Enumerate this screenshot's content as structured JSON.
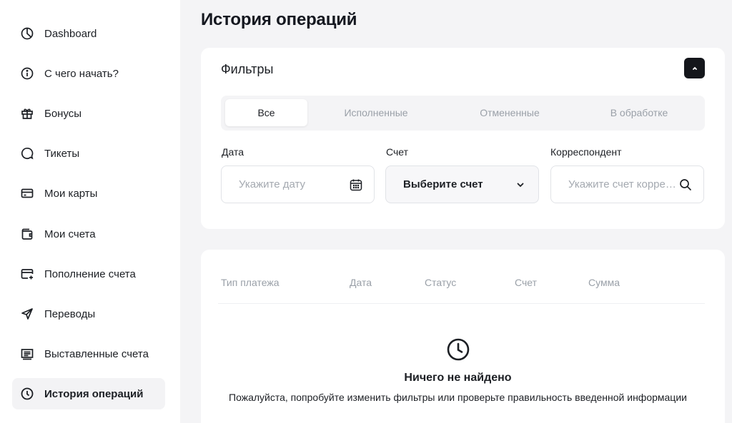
{
  "sidebar": {
    "items": [
      {
        "label": "Dashboard",
        "icon": "pie-chart-icon"
      },
      {
        "label": "С чего начать?",
        "icon": "info-icon"
      },
      {
        "label": "Бонусы",
        "icon": "gift-icon"
      },
      {
        "label": "Тикеты",
        "icon": "chat-bubble-icon"
      },
      {
        "label": "Мои карты",
        "icon": "credit-card-icon"
      },
      {
        "label": "Мои счета",
        "icon": "wallet-icon"
      },
      {
        "label": "Пополнение счета",
        "icon": "card-add-icon"
      },
      {
        "label": "Переводы",
        "icon": "send-icon"
      },
      {
        "label": "Выставленные счета",
        "icon": "invoice-icon"
      },
      {
        "label": "История операций",
        "icon": "clock-icon",
        "active": true
      }
    ]
  },
  "page": {
    "title": "История операций"
  },
  "filters": {
    "title": "Фильтры",
    "tabs": [
      {
        "label": "Все",
        "active": true
      },
      {
        "label": "Исполненные"
      },
      {
        "label": "Отмененные"
      },
      {
        "label": "В обработке"
      }
    ],
    "date": {
      "label": "Дата",
      "placeholder": "Укажите дату"
    },
    "account": {
      "label": "Счет",
      "value": "Выберите счет"
    },
    "correspondent": {
      "label": "Корреспондент",
      "placeholder": "Укажите счет корреспондента"
    }
  },
  "table": {
    "columns": [
      "Тип платежа",
      "Дата",
      "Статус",
      "Счет",
      "Сумма"
    ],
    "empty_title": "Ничего не найдено",
    "empty_text": "Пожалуйста, попробуйте изменить фильтры или проверьте правильность введенной информации"
  },
  "colors": {
    "accent": "#14161b",
    "muted": "#9aa0a8",
    "background": "#f4f4f6"
  }
}
